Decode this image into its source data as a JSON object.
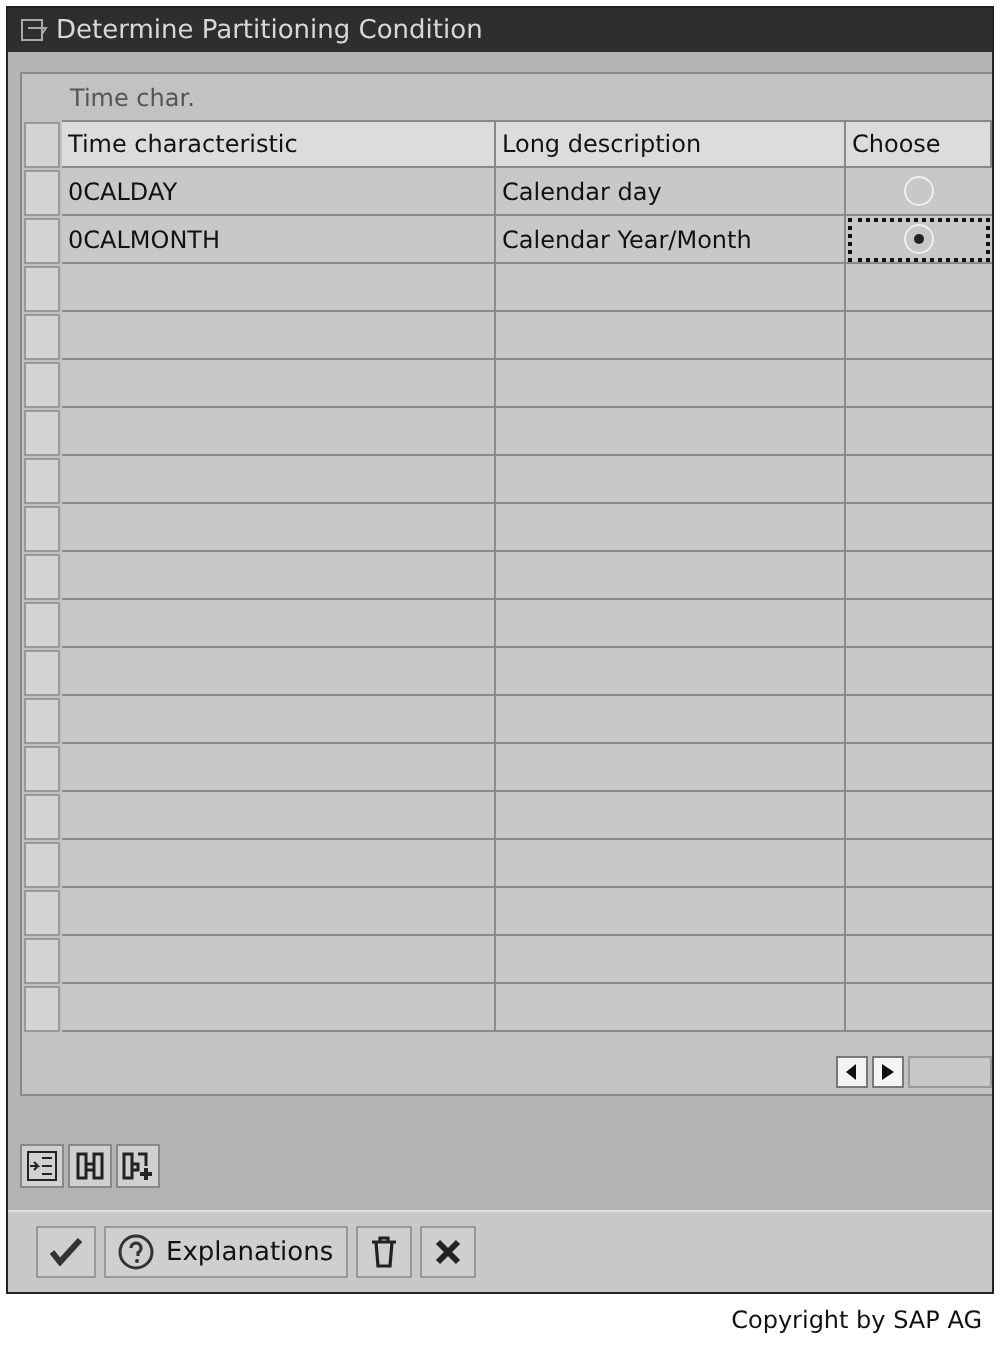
{
  "window": {
    "title": "Determine Partitioning Condition"
  },
  "table": {
    "title": "Time char.",
    "columns": [
      "Time characteristic",
      "Long description",
      "Choose"
    ],
    "rows": [
      {
        "cells": [
          "0CALDAY",
          "Calendar day"
        ],
        "selected": false
      },
      {
        "cells": [
          "0CALMONTH",
          "Calendar Year/Month"
        ],
        "selected": true
      }
    ]
  },
  "footer_buttons": [
    {
      "kind": "check"
    },
    {
      "kind": "help",
      "label": "Explanations"
    },
    {
      "kind": "trash"
    },
    {
      "kind": "cancel"
    }
  ],
  "caption": "Copyright by SAP AG"
}
